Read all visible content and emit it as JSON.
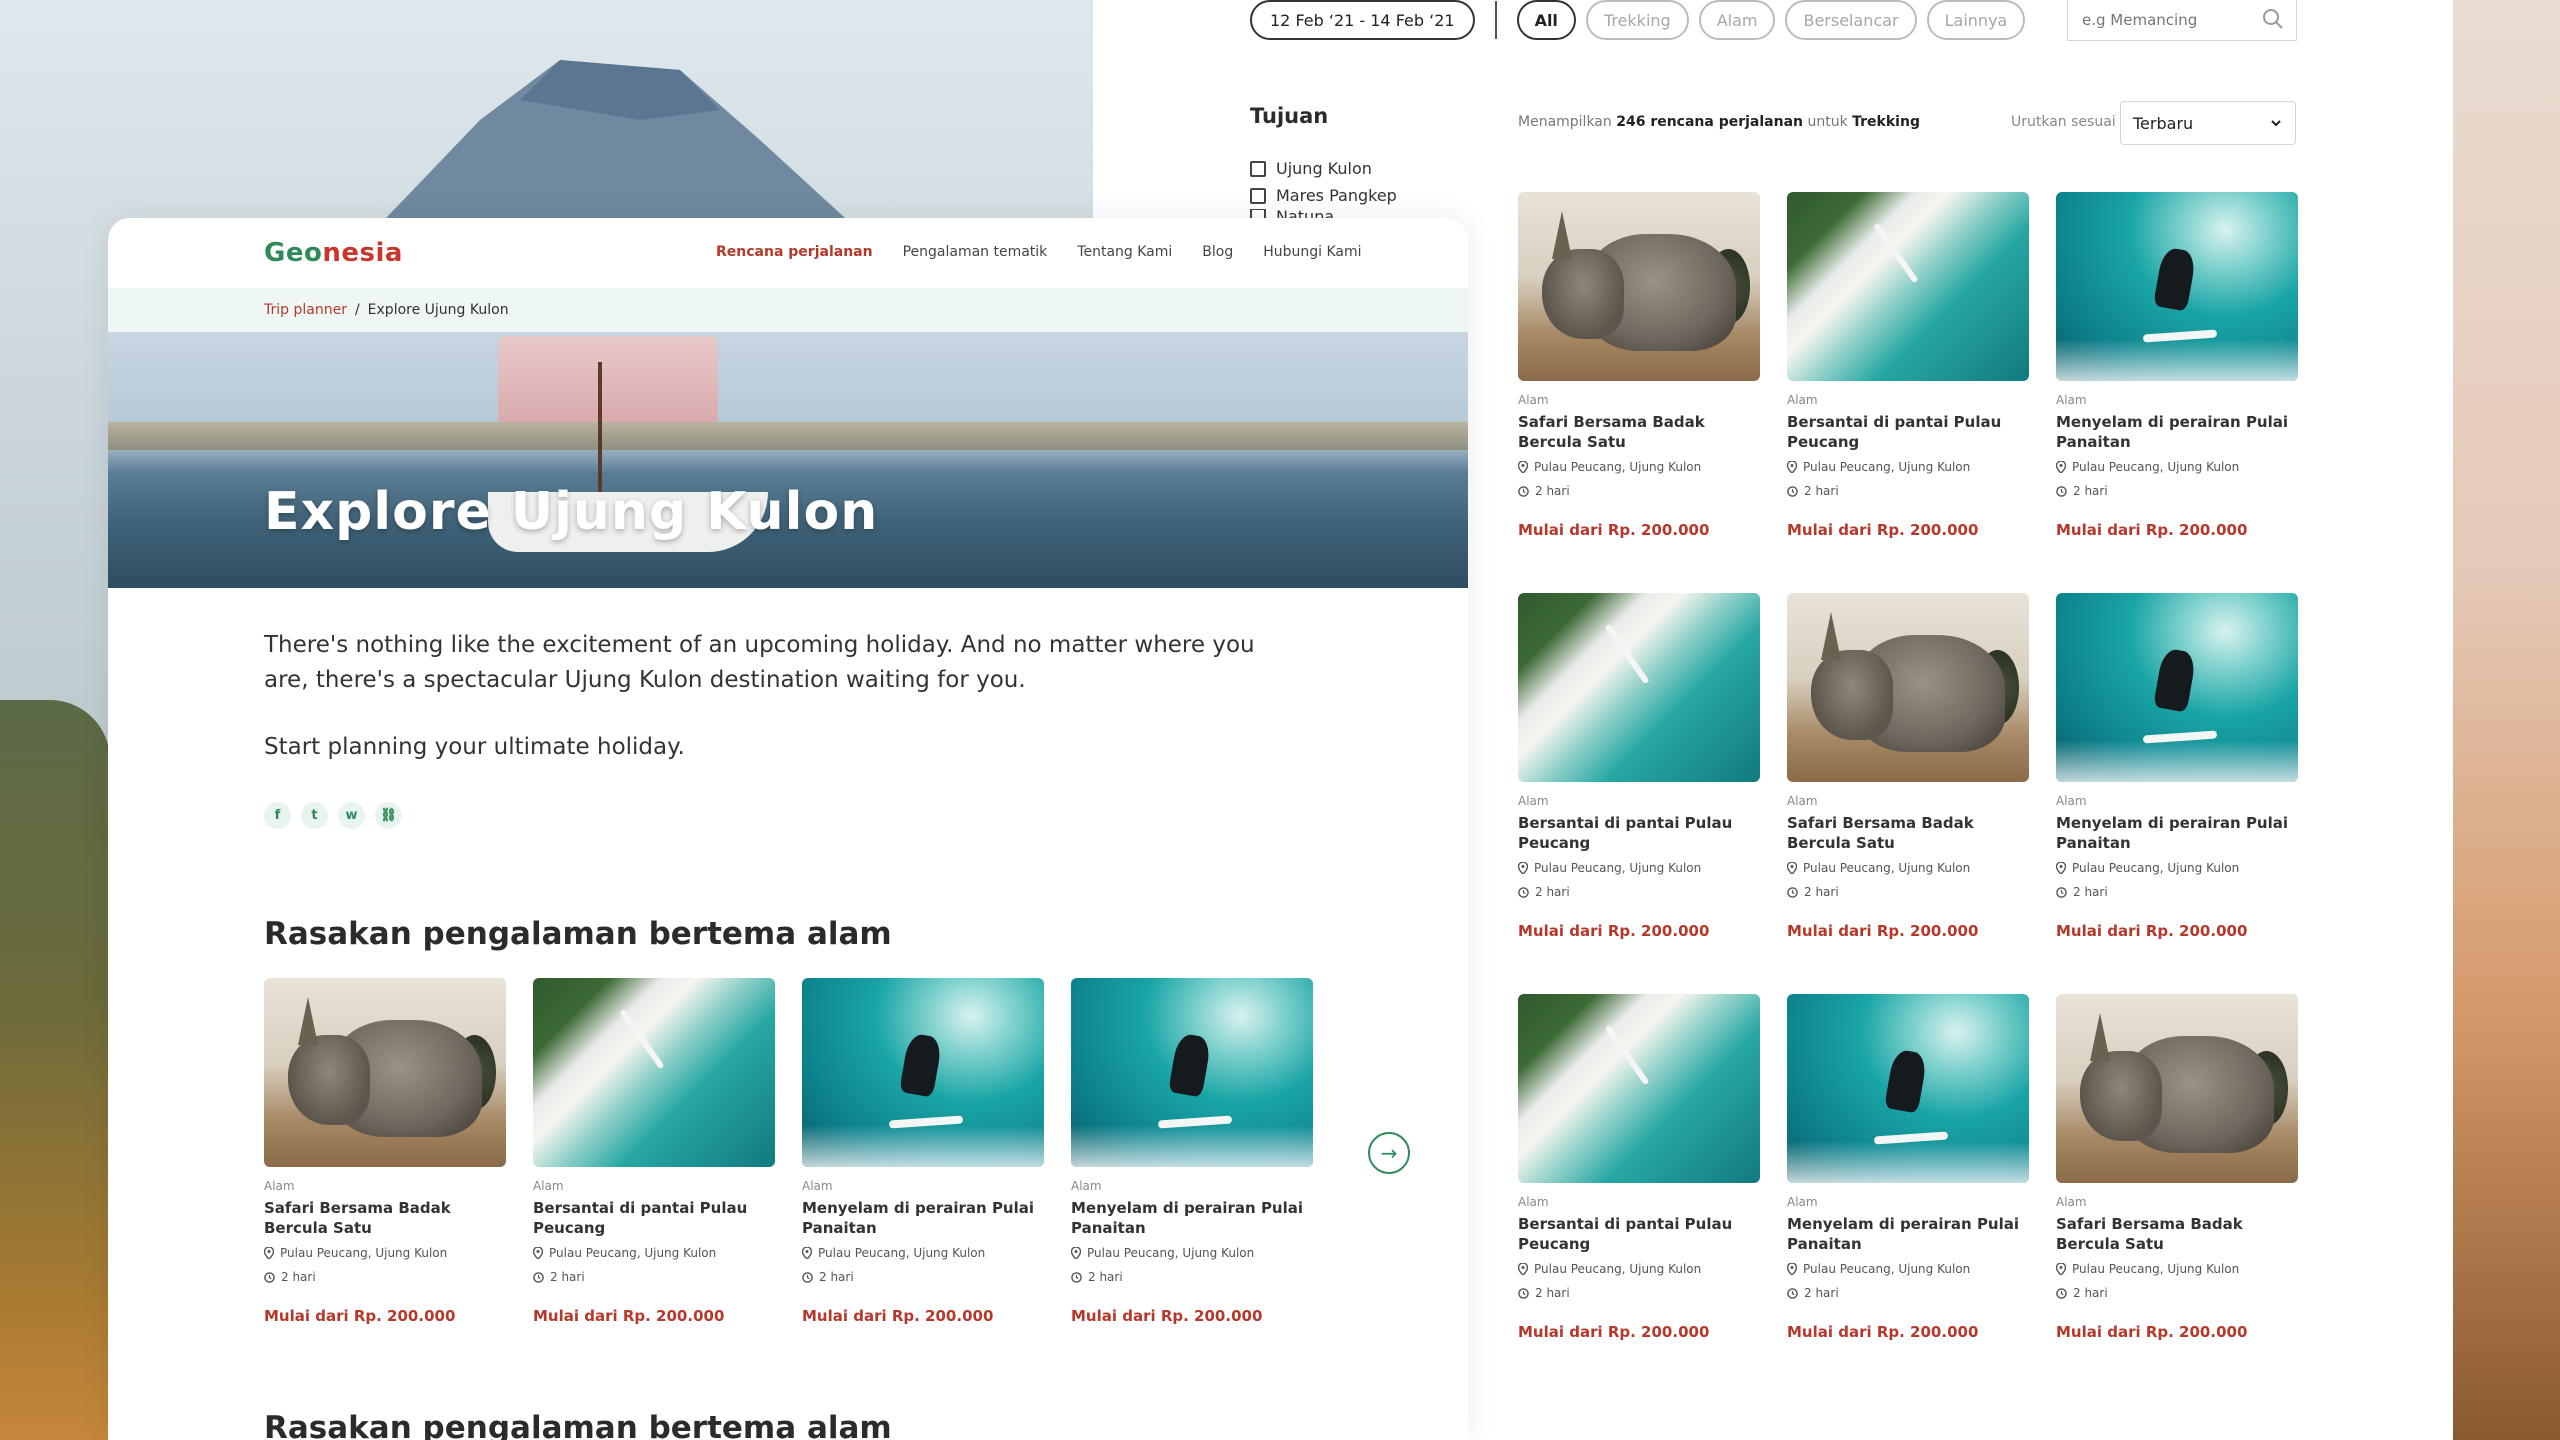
{
  "background": {
    "accent": "#2e8b57",
    "price_color": "#b5382b"
  },
  "filters": {
    "date_range": "12 Feb ‘21 - 14 Feb ‘21",
    "chips": [
      "All",
      "Trekking",
      "Alam",
      "Berselancar",
      "Lainnya"
    ],
    "search_placeholder": "e.g Memancing"
  },
  "sidebar": {
    "title": "Tujuan",
    "options": [
      "Ujung Kulon",
      "Mares Pangkep",
      "Natuna"
    ]
  },
  "results": {
    "prefix": "Menampilkan",
    "count": "246 rencana perjalanan",
    "middle": "untuk",
    "category": "Trekking",
    "sort_label": "Urutkan sesuai",
    "sort_value": "Terbaru"
  },
  "grid_cards": [
    {
      "image": "rhino",
      "category": "Alam",
      "title": "Safari Bersama Badak Bercula Satu",
      "location": "Pulau Peucang, Ujung Kulon",
      "duration": "2 hari",
      "price": "Mulai dari Rp. 200.000"
    },
    {
      "image": "beach",
      "category": "Alam",
      "title": "Bersantai di pantai Pulau Peucang",
      "location": "Pulau Peucang, Ujung Kulon",
      "duration": "2 hari",
      "price": "Mulai dari Rp. 200.000"
    },
    {
      "image": "surf",
      "category": "Alam",
      "title": "Menyelam di perairan Pulai Panaitan",
      "location": "Pulau Peucang, Ujung Kulon",
      "duration": "2 hari",
      "price": "Mulai dari Rp. 200.000"
    },
    {
      "image": "beach",
      "category": "Alam",
      "title": "Bersantai di pantai Pulau Peucang",
      "location": "Pulau Peucang, Ujung Kulon",
      "duration": "2 hari",
      "price": "Mulai dari Rp. 200.000"
    },
    {
      "image": "rhino",
      "category": "Alam",
      "title": "Safari Bersama Badak Bercula Satu",
      "location": "Pulau Peucang, Ujung Kulon",
      "duration": "2 hari",
      "price": "Mulai dari Rp. 200.000"
    },
    {
      "image": "surf",
      "category": "Alam",
      "title": "Menyelam di perairan Pulai Panaitan",
      "location": "Pulau Peucang, Ujung Kulon",
      "duration": "2 hari",
      "price": "Mulai dari Rp. 200.000"
    },
    {
      "image": "beach",
      "category": "Alam",
      "title": "Bersantai di pantai Pulau Peucang",
      "location": "Pulau Peucang, Ujung Kulon",
      "duration": "2 hari",
      "price": "Mulai dari Rp. 200.000"
    },
    {
      "image": "surf",
      "category": "Alam",
      "title": "Menyelam di perairan Pulai Panaitan",
      "location": "Pulau Peucang, Ujung Kulon",
      "duration": "2 hari",
      "price": "Mulai dari Rp. 200.000"
    },
    {
      "image": "rhino",
      "category": "Alam",
      "title": "Safari Bersama Badak Bercula Satu",
      "location": "Pulau Peucang, Ujung Kulon",
      "duration": "2 hari",
      "price": "Mulai dari Rp. 200.000"
    }
  ],
  "site": {
    "logo_part1": "Geo",
    "logo_part2": "nesia",
    "nav": [
      "Rencana perjalanan",
      "Pengalaman tematik",
      "Tentang Kami",
      "Blog",
      "Hubungi Kami"
    ],
    "breadcrumb": [
      "Trip planner",
      "Explore Ujung Kulon"
    ],
    "hero_title": "Explore Ujung Kulon",
    "intro_p1": "There's nothing like the excitement of an upcoming holiday. And no matter where you are, there's a spectacular Ujung Kulon destination waiting for you.",
    "intro_p2": "Start planning your ultimate holiday.",
    "section_title": "Rasakan pengalaman bertema alam",
    "section_title_2": "Rasakan pengalaman bertema alam"
  },
  "row_cards": [
    {
      "image": "rhino",
      "category": "Alam",
      "title": "Safari Bersama Badak Bercula Satu",
      "location": "Pulau Peucang, Ujung Kulon",
      "duration": "2 hari",
      "price": "Mulai dari Rp. 200.000"
    },
    {
      "image": "beach",
      "category": "Alam",
      "title": "Bersantai di pantai Pulau Peucang",
      "location": "Pulau Peucang, Ujung Kulon",
      "duration": "2 hari",
      "price": "Mulai dari Rp. 200.000"
    },
    {
      "image": "surf",
      "category": "Alam",
      "title": "Menyelam di perairan Pulai Panaitan",
      "location": "Pulau Peucang, Ujung Kulon",
      "duration": "2 hari",
      "price": "Mulai dari Rp. 200.000"
    },
    {
      "image": "surf",
      "category": "Alam",
      "title": "Menyelam di perairan Pulai Panaitan",
      "location": "Pulau Peucang, Ujung Kulon",
      "duration": "2 hari",
      "price": "Mulai dari Rp. 200.000"
    }
  ]
}
